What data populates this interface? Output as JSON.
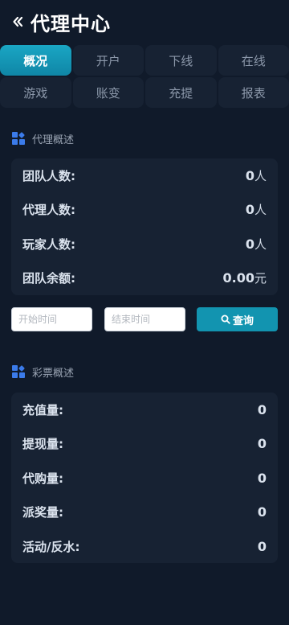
{
  "header": {
    "title": "代理中心"
  },
  "tabs": [
    {
      "label": "概况"
    },
    {
      "label": "开户"
    },
    {
      "label": "下线"
    },
    {
      "label": "在线"
    },
    {
      "label": "游戏"
    },
    {
      "label": "账变"
    },
    {
      "label": "充提"
    },
    {
      "label": "报表"
    }
  ],
  "agent_overview": {
    "title": "代理概述",
    "rows": [
      {
        "label": "团队人数:",
        "value": "0",
        "unit": "人"
      },
      {
        "label": "代理人数:",
        "value": "0",
        "unit": "人"
      },
      {
        "label": "玩家人数:",
        "value": "0",
        "unit": "人"
      },
      {
        "label": "团队余额:",
        "value": "0.00",
        "unit": "元"
      }
    ]
  },
  "search": {
    "start_placeholder": "开始时间",
    "end_placeholder": "结束时间",
    "query_label": "查询"
  },
  "lottery_overview": {
    "title": "彩票概述",
    "rows": [
      {
        "label": "充值量:",
        "value": "0"
      },
      {
        "label": "提现量:",
        "value": "0"
      },
      {
        "label": "代购量:",
        "value": "0"
      },
      {
        "label": "派奖量:",
        "value": "0"
      },
      {
        "label": "活动/反水:",
        "value": "0"
      }
    ]
  },
  "colors": {
    "accent": "#1294b0",
    "background": "#101a2a",
    "card": "#172233"
  }
}
